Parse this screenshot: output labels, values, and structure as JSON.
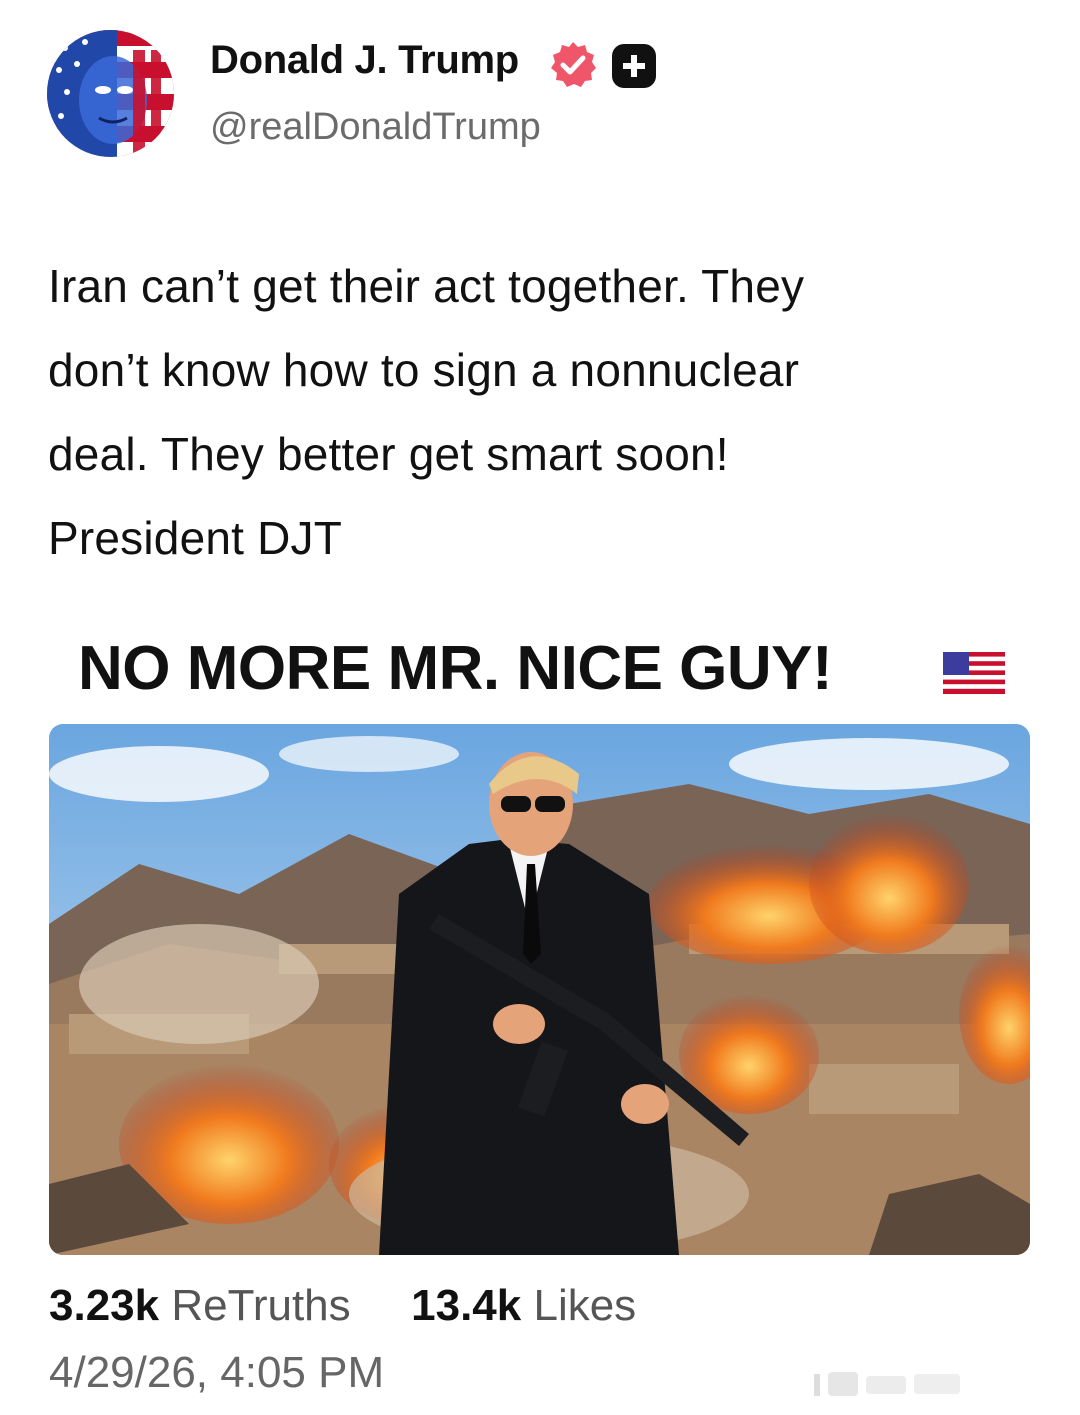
{
  "author": {
    "display_name": "Donald J. Trump",
    "handle": "@realDonaldTrump",
    "verified_color": "#f0566a"
  },
  "post": {
    "lines": [
      "Iran can’t get their act together. They",
      "don’t know how to sign a nonnuclear",
      "deal. They better get smart soon!",
      "President DJT"
    ]
  },
  "media": {
    "headline": "NO MORE MR. NICE GUY!",
    "headline_icon": "us-flag-icon"
  },
  "stats": {
    "retruths_count": "3.23k",
    "retruths_label": "ReTruths",
    "likes_count": "13.4k",
    "likes_label": "Likes",
    "timestamp": "4/29/26, 4:05 PM"
  },
  "icons": {
    "verified": "verified-badge-icon",
    "plus": "plus-badge-icon"
  }
}
